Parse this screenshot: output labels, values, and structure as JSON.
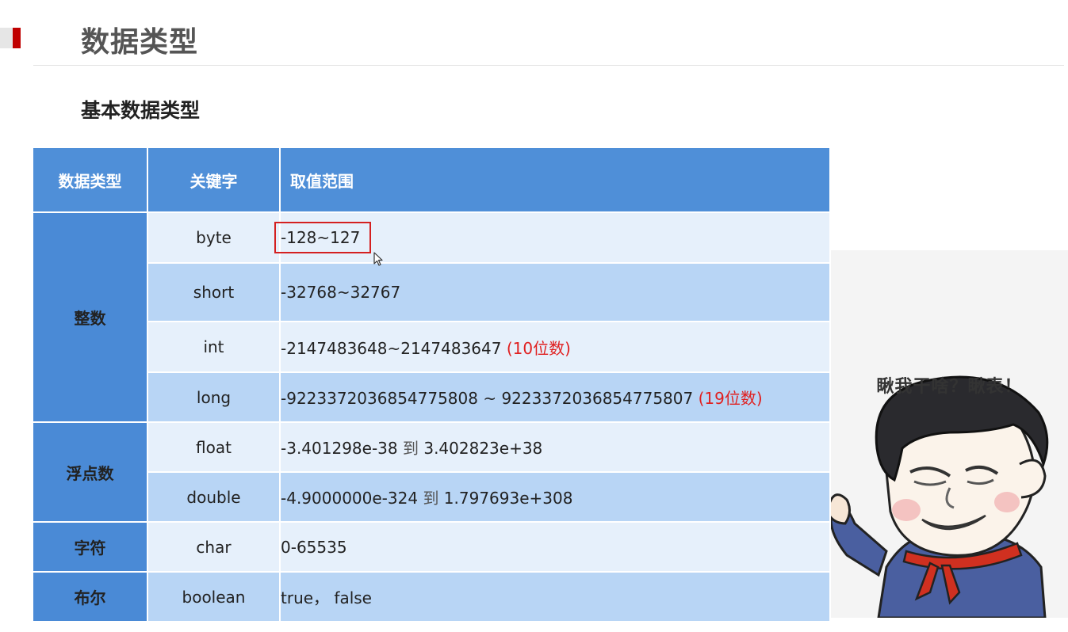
{
  "slide": {
    "title": "数据类型",
    "subtitle": "基本数据类型"
  },
  "table": {
    "headers": [
      "数据类型",
      "关键字",
      "取值范围"
    ],
    "groups": {
      "integer": "整数",
      "float": "浮点数",
      "char": "字符",
      "bool": "布尔"
    },
    "rows": [
      {
        "keyword": "byte",
        "range": "-128~127"
      },
      {
        "keyword": "short",
        "range": "-32768~32767"
      },
      {
        "keyword": "int",
        "range": "-2147483648~2147483647",
        "note": "(10位数)"
      },
      {
        "keyword": "long",
        "range": "-9223372036854775808 ~ 9223372036854775807",
        "note": "(19位数)"
      },
      {
        "keyword": "float",
        "range_from": "-3.401298e-38",
        "range_sep": "到",
        "range_to": "3.402823e+38"
      },
      {
        "keyword": "double",
        "range_from": "-4.9000000e-324",
        "range_sep": "到",
        "range_to": "1.797693e+308"
      },
      {
        "keyword": "char",
        "range": "0-65535"
      },
      {
        "keyword": "boolean",
        "range": "true， false"
      }
    ]
  },
  "meme": {
    "caption": "瞅我干啥？瞅表！"
  },
  "colors": {
    "accent": "#c00000",
    "header_blue": "#4f8fd8",
    "highlight_red": "#e02020"
  }
}
